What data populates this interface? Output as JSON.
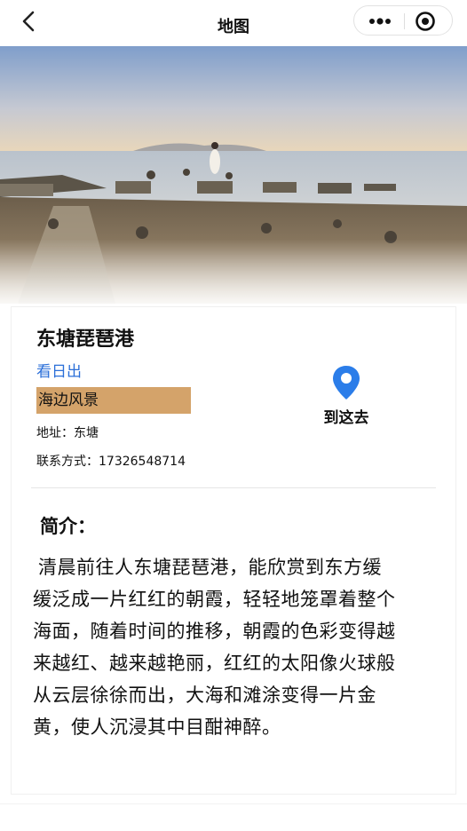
{
  "nav": {
    "title": "地图"
  },
  "place": {
    "name": "东塘琵琶港",
    "tag_link": "看日出",
    "tag_box": "海边风景",
    "address": "地址：东塘",
    "contact": "联系方式：17326548714"
  },
  "actions": {
    "goto_label": "到这去"
  },
  "intro": {
    "title": "简介：",
    "body": "清晨前往人东塘琵琶港，能欣赏到东方缓缓泛成一片红红的朝霞，轻轻地笼罩着整个海面，随着时间的推移，朝霞的色彩变得越来越红、越来越艳丽，红红的太阳像火球般从云层徐徐而出，大海和滩涂变得一片金黄，使人沉浸其中目酣神醉。"
  },
  "colors": {
    "accent": "#2b6fd8",
    "tag_bg": "#d4a36a"
  },
  "icons": [
    "back-arrow-icon",
    "more-dots-icon",
    "target-icon",
    "location-pin-icon"
  ]
}
